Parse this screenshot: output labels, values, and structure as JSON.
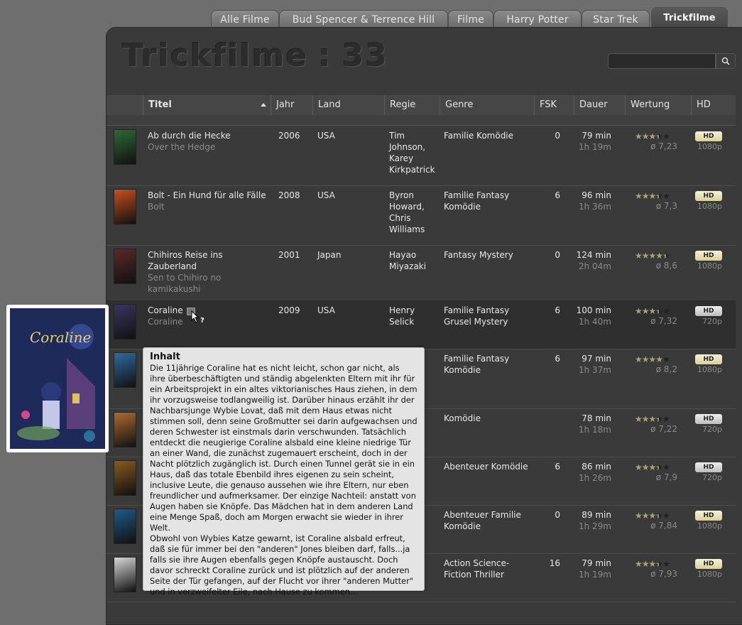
{
  "tabs": [
    {
      "label": "Alle Filme",
      "active": false
    },
    {
      "label": "Bud Spencer & Terrence Hill",
      "active": false
    },
    {
      "label": "Filme",
      "active": false
    },
    {
      "label": "Harry Potter",
      "active": false
    },
    {
      "label": "Star Trek",
      "active": false
    },
    {
      "label": "Trickfilme",
      "active": true
    }
  ],
  "heading": {
    "title": "Trickfilme",
    "separator": ":",
    "count": "33"
  },
  "search": {
    "placeholder": "",
    "value": "",
    "icon": "search-icon"
  },
  "columns": [
    {
      "key": "poster",
      "label": ""
    },
    {
      "key": "titel",
      "label": "Titel",
      "sorted": "asc"
    },
    {
      "key": "jahr",
      "label": "Jahr"
    },
    {
      "key": "land",
      "label": "Land"
    },
    {
      "key": "regie",
      "label": "Regie"
    },
    {
      "key": "genre",
      "label": "Genre"
    },
    {
      "key": "fsk",
      "label": "FSK"
    },
    {
      "key": "dauer",
      "label": "Dauer"
    },
    {
      "key": "wertung",
      "label": "Wertung"
    },
    {
      "key": "hd",
      "label": "HD"
    }
  ],
  "colors": {
    "poster_colors": [
      "#2e6a3a",
      "#c8501e",
      "#5a2a2a",
      "#3a3560",
      "#2f6aa0",
      "#b06a30",
      "#8a5a20",
      "#1f5a8a",
      "#d8d8d8"
    ]
  },
  "rows": [
    {
      "title": "Ab durch die Hecke",
      "orig": "Over the Hedge",
      "year": "2006",
      "land": "USA",
      "regie": [
        "Tim",
        "Johnson,",
        "Karey",
        "Kirkpatrick"
      ],
      "genre": [
        "Familie Komödie"
      ],
      "fsk": "0",
      "min": "79 min",
      "hm": "1h 19m",
      "stars": 3.5,
      "rating": "ø 7,23",
      "hd": "HD",
      "res": "1080p",
      "hdgold": true
    },
    {
      "title": "Bolt - Ein Hund für alle Fälle",
      "orig": "Bolt",
      "year": "2008",
      "land": "USA",
      "regie": [
        "Byron",
        "Howard,",
        "Chris",
        "Williams"
      ],
      "genre": [
        "Familie Fantasy",
        "Komödie"
      ],
      "fsk": "6",
      "min": "96 min",
      "hm": "1h 36m",
      "stars": 3.5,
      "rating": "ø 7,3",
      "hd": "HD",
      "res": "1080p",
      "hdgold": true
    },
    {
      "title": "Chihiros Reise ins",
      "title2": "Zauberland",
      "orig": "Sen to Chihiro no",
      "orig2": "kamikakushi",
      "year": "2001",
      "land": "Japan",
      "regie": [
        "Hayao",
        "Miyazaki"
      ],
      "genre": [
        "Fantasy Mystery"
      ],
      "fsk": "0",
      "min": "124 min",
      "hm": "2h 04m",
      "stars": 4.3,
      "rating": "ø 8,6",
      "hd": "HD",
      "res": "1080p",
      "hdgold": true
    },
    {
      "title": "Coraline",
      "orig": "Coraline",
      "year": "2009",
      "land": "USA",
      "regie": [
        "Henry",
        "Selick"
      ],
      "genre": [
        "Familie Fantasy",
        "Grusel Mystery"
      ],
      "fsk": "6",
      "min": "100 min",
      "hm": "1h 40m",
      "stars": 3.6,
      "rating": "ø 7,32",
      "hd": "HD",
      "res": "720p",
      "hdgold": false
    },
    {
      "title": "",
      "orig": "",
      "year": "",
      "land": "",
      "regie": [],
      "genre": [
        "Familie Fantasy",
        "Komödie"
      ],
      "fsk": "6",
      "min": "97 min",
      "hm": "1h 37m",
      "stars": 4.1,
      "rating": "ø 8,2",
      "hd": "HD",
      "res": "1080p",
      "hdgold": true
    },
    {
      "title": "",
      "orig": "",
      "year": "",
      "land": "",
      "regie": [],
      "genre": [
        "Komödie"
      ],
      "fsk": "",
      "min": "78 min",
      "hm": "1h 18m",
      "stars": 3.6,
      "rating": "ø 7,22",
      "hd": "HD",
      "res": "720p",
      "hdgold": false
    },
    {
      "title": "",
      "orig": "",
      "year": "",
      "land": "",
      "regie": [],
      "genre": [
        "Abenteuer Komödie"
      ],
      "fsk": "6",
      "min": "86 min",
      "hm": "1h 26m",
      "stars": 3.9,
      "rating": "ø 7,9",
      "hd": "HD",
      "res": "720p",
      "hdgold": false
    },
    {
      "title": "",
      "orig": "",
      "year": "",
      "land": "",
      "regie": [],
      "genre": [
        "Abenteuer Familie",
        "Komödie"
      ],
      "fsk": "0",
      "min": "89 min",
      "hm": "1h 29m",
      "stars": 3.9,
      "rating": "ø 7,84",
      "hd": "HD",
      "res": "1080p",
      "hdgold": true
    },
    {
      "title": "",
      "orig": "",
      "year": "",
      "land": "",
      "regie": [],
      "genre": [
        "Action Science-",
        "Fiction Thriller"
      ],
      "fsk": "16",
      "min": "79 min",
      "hm": "1h 19m",
      "stars": 3.9,
      "rating": "ø 7,93",
      "hd": "HD",
      "res": "1080p",
      "hdgold": true
    }
  ],
  "tooltip": {
    "title": "Inhalt",
    "text": "Die 11jährige Coraline hat es nicht leicht, schon gar nicht, als ihre überbeschäftigten und ständig abgelenkten Eltern mit ihr für ein Arbeitsprojekt in ein altes viktorianisches Haus ziehen, in dem ihr vorzugsweise todlangweilig ist. Darüber hinaus erzählt ihr der Nachbarsjunge Wybie Lovat, daß mit dem Haus etwas nicht stimmen soll, denn seine Großmutter sei darin aufgewachsen und deren Schwester ist einstmals darin verschwunden. Tatsächlich entdeckt die neugierige Coraline alsbald eine kleine niedrige Tür an einer Wand, die zunächst zugemauert erscheint, doch in der Nacht plötzlich zugänglich ist. Durch einen Tunnel gerät sie in ein Haus, daß das totale Ebenbild ihres eigenen zu sein scheint, inclusive Leute, die genauso aussehen wie ihre Eltern, nur eben freundlicher und aufmerksamer. Der einzige Nachteil: anstatt von Augen haben sie Knöpfe. Das Mädchen hat in dem anderen Land eine Menge Spaß, doch am Morgen erwacht sie wieder in ihrer Welt.\nObwohl von Wybies Katze gewarnt, ist Coraline alsbald erfreut, daß sie für immer bei den \"anderen\" Jones bleiben darf, falls...ja falls sie ihre Augen ebenfalls gegen Knöpfe austauscht. Doch davor schreckt Coraline zurück und ist plötzlich auf der anderen Seite der Tür gefangen, auf der Flucht vor ihrer \"anderen Mutter\" und in verzweifelter Eile, nach Hause zu kommen..."
  },
  "cursor_help": "?"
}
